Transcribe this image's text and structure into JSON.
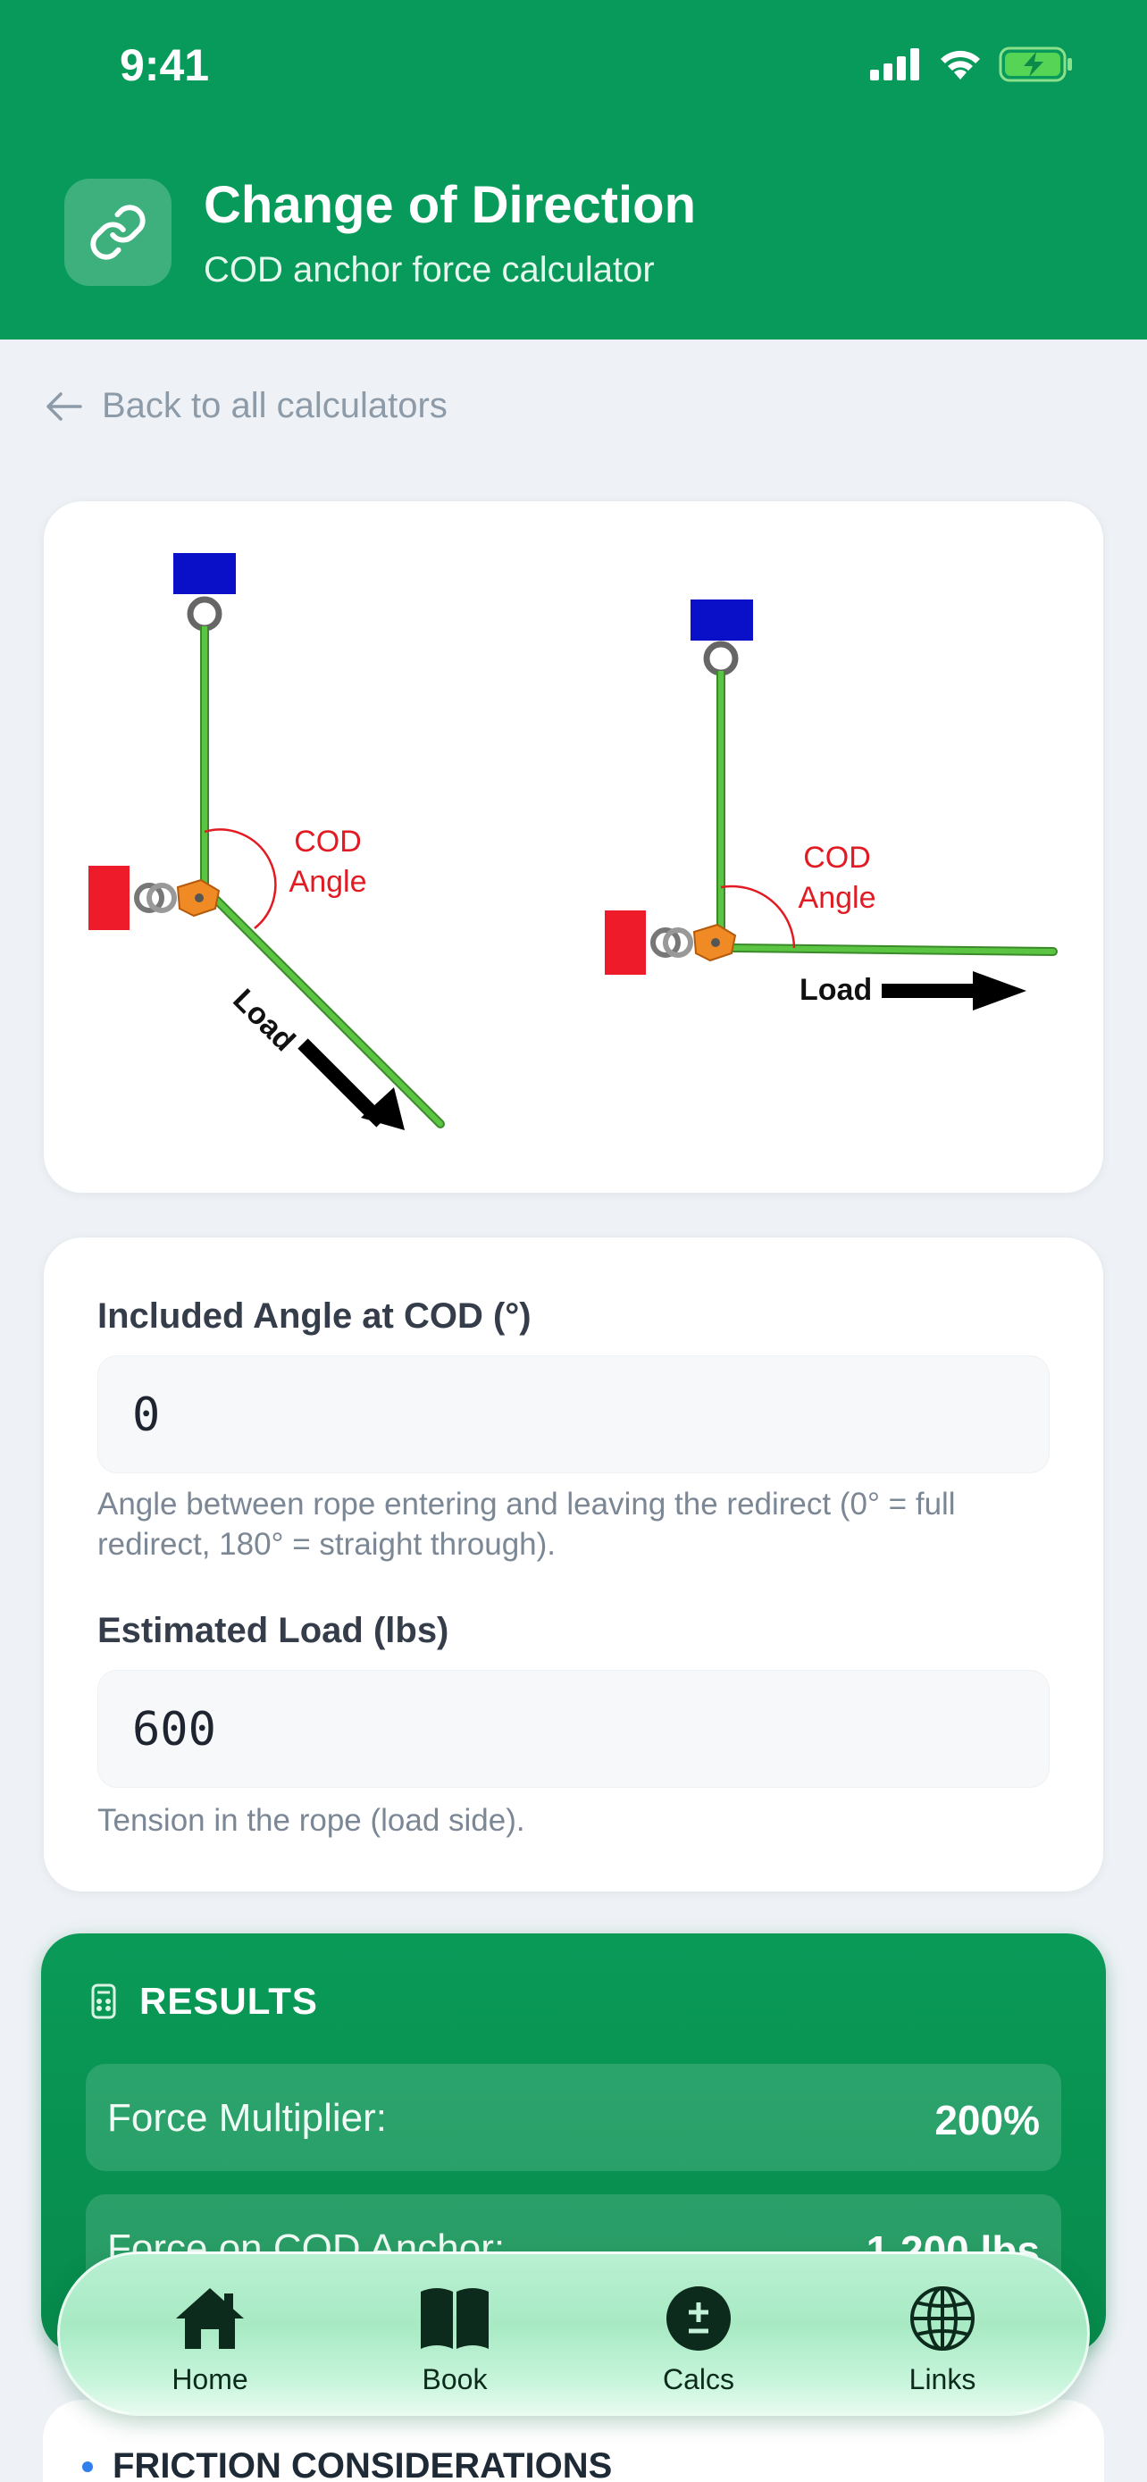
{
  "status": {
    "time": "9:41"
  },
  "header": {
    "icon": "link-icon",
    "title": "Change of Direction",
    "subtitle": "COD anchor force calculator"
  },
  "back": {
    "label": "Back to all calculators"
  },
  "diagram": {
    "left": {
      "angle_label_1": "COD",
      "angle_label_2": "Angle",
      "load_label": "Load"
    },
    "right": {
      "angle_label_1": "COD",
      "angle_label_2": "Angle",
      "load_label": "Load"
    }
  },
  "inputs": {
    "angle": {
      "label": "Included Angle at COD (°)",
      "value": "0",
      "help": "Angle between rope entering and leaving the redirect (0° = full redirect, 180° = straight through)."
    },
    "load": {
      "label": "Estimated Load (lbs)",
      "value": "600",
      "help": "Tension in the rope (load side)."
    }
  },
  "results": {
    "title": "RESULTS",
    "rows": [
      {
        "label": "Force Multiplier:",
        "value": "200%"
      },
      {
        "label": "Force on COD Anchor:",
        "value": "1,200 lbs"
      }
    ]
  },
  "friction": {
    "title": "FRICTION CONSIDERATIONS"
  },
  "tabs": [
    {
      "label": "Home",
      "icon": "home-icon"
    },
    {
      "label": "Book",
      "icon": "book-icon"
    },
    {
      "label": "Calcs",
      "icon": "plus-minus-icon"
    },
    {
      "label": "Links",
      "icon": "globe-icon"
    }
  ],
  "colors": {
    "header": "#079a5a",
    "rope": "#4cb43c",
    "anchor_top": "#0a0fc8",
    "anchor_side": "#ee1c2b",
    "angle_arc": "#e21b23"
  }
}
